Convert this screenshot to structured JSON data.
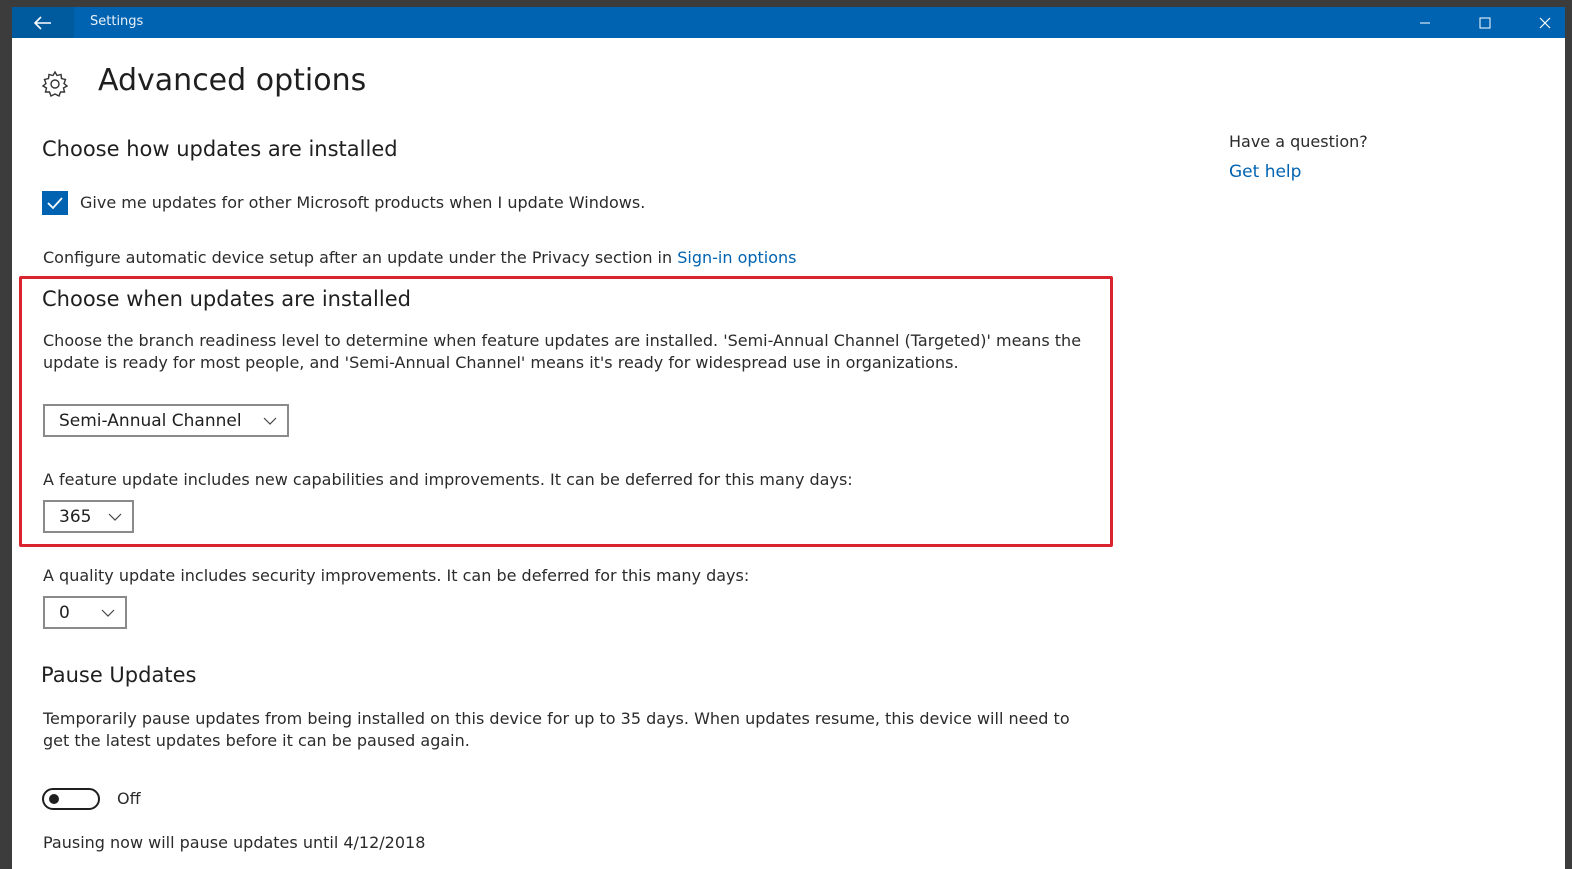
{
  "window": {
    "title": "Settings"
  },
  "page": {
    "title": "Advanced options"
  },
  "install_section": {
    "heading": "Choose how updates are installed",
    "checkbox_label": "Give me updates for other Microsoft products when I update Windows.",
    "checkbox_checked": true,
    "config_text": "Configure automatic device setup after an update under the Privacy section in",
    "config_link": "Sign-in options"
  },
  "when_section": {
    "heading": "Choose when updates are installed",
    "description": "Choose the branch readiness level to determine when feature updates are installed. 'Semi-Annual Channel (Targeted)' means the update is ready for most people, and 'Semi-Annual Channel' means it's ready for widespread use in organizations.",
    "branch_value": "Semi-Annual Channel",
    "feature_text": "A feature update includes new capabilities and improvements. It can be deferred for this many days:",
    "feature_value": "365"
  },
  "quality": {
    "text": "A quality update includes security improvements. It can be deferred for this many days:",
    "value": "0"
  },
  "pause_section": {
    "heading": "Pause Updates",
    "description": "Temporarily pause updates from being installed on this device for up to 35 days. When updates resume, this device will need to get the latest updates before it can be paused again.",
    "toggle_state": "Off",
    "until_text": "Pausing now will pause updates until 4/12/2018"
  },
  "help": {
    "question": "Have a question?",
    "link": "Get help"
  },
  "colors": {
    "accent": "#0063b1",
    "titlebar": "#0063b1",
    "highlight": "#d9232e"
  },
  "icons": {
    "back": "back-arrow-icon",
    "gear": "gear-icon",
    "minimize": "minimize-icon",
    "maximize": "maximize-icon",
    "close": "close-icon",
    "checkmark": "checkmark-icon",
    "chevron": "chevron-down-icon"
  }
}
